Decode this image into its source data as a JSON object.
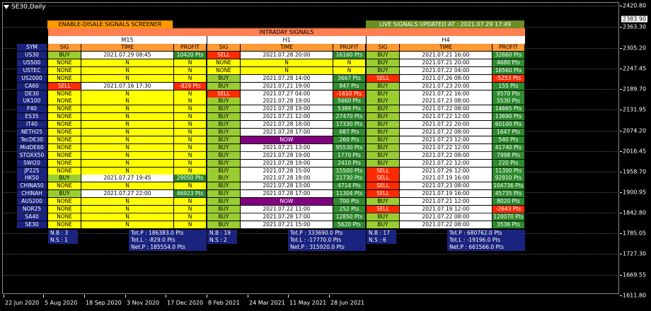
{
  "window": {
    "symbol_timeframe": "SE30,Daily"
  },
  "banners": {
    "enable": "ENABLE-DISALE SIGNALS SCREENER",
    "live": "LIVE SIGNALS UPDATED AT : 2021.07.29 17:49"
  },
  "headers": {
    "intraday": "INTRADAY SIGNALS",
    "timeframes": [
      "M15",
      "H1",
      "H4"
    ],
    "sym": "SYM",
    "sig": "SIG",
    "time": "TIME",
    "profit": "PROFIT"
  },
  "price_axis": {
    "labels": [
      "2420.80",
      "2363.30",
      "2305.20",
      "2247.45",
      "2189.70",
      "2131.95",
      "2074.20",
      "2016.45",
      "1958.70",
      "1900.95",
      "1842.80",
      "1785.05",
      "1727.30",
      "1669.55",
      "1611.80"
    ],
    "current": "2383.90"
  },
  "time_axis": [
    "22 Jun 2020",
    "5 Aug 2020",
    "18 Sep 2020",
    "3 Nov 2020",
    "17 Dec 2020",
    "8 Feb 2021",
    "24 Mar 2021",
    "11 May 2021",
    "28 Jun 2021"
  ],
  "colors": {
    "yellow": "#ffff00",
    "green": "#2e8b2e",
    "lightgreen": "#9acd32",
    "red": "#ff2a00",
    "navy": "#1a237e",
    "orange": "#ff9933"
  },
  "rows": [
    {
      "sym": "US30",
      "m15": [
        "BUY",
        "2021.07.29 08:45",
        "10420 Pts"
      ],
      "h1": [
        "SELL",
        "2021.07.28 20:00",
        "16160 Pts"
      ],
      "h4": [
        "BUY",
        "2021.07.21 16:00",
        "32660 Pts"
      ]
    },
    {
      "sym": "US500",
      "m15": [
        "NONE",
        "N",
        "N"
      ],
      "h1": [
        "NONE",
        "N",
        "N"
      ],
      "h4": [
        "BUY",
        "2021.07.21 20:00",
        "4680 Pts"
      ]
    },
    {
      "sym": "USTEC",
      "m15": [
        "NONE",
        "N",
        "N"
      ],
      "h1": [
        "NONE",
        "N",
        "N"
      ],
      "h4": [
        "BUY",
        "2021.07.22 04:00",
        "16560 Pts"
      ]
    },
    {
      "sym": "US2000",
      "m15": [
        "NONE",
        "N",
        "N"
      ],
      "h1": [
        "BUY",
        "2021.07.28 14:00",
        "3667 Pts"
      ],
      "h4": [
        "SELL",
        "2021.07.26 08:00",
        "-5253 Pts"
      ]
    },
    {
      "sym": "CA60",
      "m15": [
        "SELL",
        "2021.07.16 17:30",
        "-829 Pts"
      ],
      "h1": [
        "BUY",
        "2021.07.21 19:00",
        "847 Pts"
      ],
      "h4": [
        "BUY",
        "2021.07.23 20:00",
        "155 Pts"
      ]
    },
    {
      "sym": "DE30",
      "m15": [
        "NONE",
        "N",
        "N"
      ],
      "h1": [
        "SELL",
        "2021.07.27 04:00",
        "-1610 Pts"
      ],
      "h4": [
        "BUY",
        "2021.07.22 16:00",
        "9570 Pts"
      ]
    },
    {
      "sym": "UK100",
      "m15": [
        "NONE",
        "N",
        "N"
      ],
      "h1": [
        "BUY",
        "2021.07.28 19:00",
        "5660 Pts"
      ],
      "h4": [
        "BUY",
        "2021.07.23 08:00",
        "5530 Pts"
      ]
    },
    {
      "sym": "F40",
      "m15": [
        "NONE",
        "N",
        "N"
      ],
      "h1": [
        "BUY",
        "2021.07.28 19:00",
        "5389 Pts"
      ],
      "h4": [
        "BUY",
        "2021.07.22 08:00",
        "14665 Pts"
      ]
    },
    {
      "sym": "ES35",
      "m15": [
        "NONE",
        "N",
        "N"
      ],
      "h1": [
        "BUY",
        "2021.07.21 12:00",
        "27470 Pts"
      ],
      "h4": [
        "BUY",
        "2021.07.22 12:00",
        "13690 Pts"
      ]
    },
    {
      "sym": "IT40",
      "m15": [
        "NONE",
        "N",
        "N"
      ],
      "h1": [
        "BUY",
        "2021.07.28 18:00",
        "17330 Pts"
      ],
      "h4": [
        "BUY",
        "2021.07.22 20:00",
        "60100 Pts"
      ]
    },
    {
      "sym": "NETH25",
      "m15": [
        "NONE",
        "N",
        "N"
      ],
      "h1": [
        "BUY",
        "2021.07.28 17:00",
        "687 Pts"
      ],
      "h4": [
        "BUY",
        "2021.07.22 08:00",
        "1647 Pts"
      ]
    },
    {
      "sym": "TecDE30",
      "m15": [
        "NONE",
        "N",
        "N"
      ],
      "h1": [
        "NOW",
        "NOW",
        "260 Pts"
      ],
      "h4": [
        "BUY",
        "2021.07.23 12:00",
        "540 Pts"
      ]
    },
    {
      "sym": "MidDE60",
      "m15": [
        "NONE",
        "N",
        "N"
      ],
      "h1": [
        "BUY",
        "2021.07.21 13:00",
        "95530 Pts"
      ],
      "h4": [
        "BUY",
        "2021.07.22 12:00",
        "41740 Pts"
      ]
    },
    {
      "sym": "STOXX50",
      "m15": [
        "NONE",
        "N",
        "N"
      ],
      "h1": [
        "BUY",
        "2021.07.28 19:00",
        "1770 Pts"
      ],
      "h4": [
        "BUY",
        "2021.07.22 08:00",
        "7998 Pts"
      ]
    },
    {
      "sym": "SWI20",
      "m15": [
        "NONE",
        "N",
        "N"
      ],
      "h1": [
        "BUY",
        "2021.07.28 19:00",
        "2410 Pts"
      ],
      "h4": [
        "BUY",
        "2021.07.22 12:00",
        "220 Pts"
      ]
    },
    {
      "sym": "JP225",
      "m15": [
        "NONE",
        "N",
        "N"
      ],
      "h1": [
        "BUY",
        "2021.07.28 15:00",
        "15500 Pts"
      ],
      "h4": [
        "SELL",
        "2021.07.26 12:00",
        "11300 Pts"
      ]
    },
    {
      "sym": "HK50",
      "m15": [
        "BUY",
        "2021.07.27 19:45",
        "29050 Pts"
      ],
      "h1": [
        "BUY",
        "2021.07.28 18:00",
        "21730 Pts"
      ],
      "h4": [
        "SELL",
        "2021.07.19 16:00",
        "92910 Pts"
      ]
    },
    {
      "sym": "CHINA50",
      "m15": [
        "NONE",
        "N",
        "N"
      ],
      "h1": [
        "BUY",
        "2021.07.28 13:00",
        "4714 Pts"
      ],
      "h4": [
        "SELL",
        "2021.07.23 08:00",
        "104736 Pts"
      ]
    },
    {
      "sym": "CHINAH",
      "m15": [
        "BUY",
        "2021.07.27 22:00",
        "46923 Pts"
      ],
      "h1": [
        "BUY",
        "2021.07.28 17:00",
        "11304 Pts"
      ],
      "h4": [
        "SELL",
        "2021.07.19 16:00",
        "45735 Pts"
      ]
    },
    {
      "sym": "AUS200",
      "m15": [
        "NONE",
        "N",
        "N"
      ],
      "h1": [
        "NOW",
        "NOW",
        "700 Pts"
      ],
      "h4": [
        "BUY",
        "2021.07.21 12:00",
        "8020 Pts"
      ]
    },
    {
      "sym": "NOR25",
      "m15": [
        "NONE",
        "N",
        "N"
      ],
      "h1": [
        "BUY",
        "2021.07.22 11:00",
        "252 Pts"
      ],
      "h4": [
        "SELL",
        "2021.07.19 12:00",
        "-2643 Pts"
      ]
    },
    {
      "sym": "SA40",
      "m15": [
        "NONE",
        "N",
        "N"
      ],
      "h1": [
        "BUY",
        "2021.07.28 17:00",
        "12850 Pts"
      ],
      "h4": [
        "BUY",
        "2021.07.22 08:00",
        "120070 Pts"
      ]
    },
    {
      "sym": "SE30",
      "m15": [
        "NONE",
        "N",
        "N"
      ],
      "h1": [
        "BUY",
        "2021.07.21 15:00",
        "5620 Pts"
      ],
      "h4": [
        "BUY",
        "2021.07.22 08:00",
        "3536 Pts"
      ]
    }
  ],
  "summary": {
    "m15": {
      "nb": "N.B : 3",
      "ns": "N.S : 1",
      "totp": "Tot.P : 186383.0 Pts",
      "totl": "Tot.L : -829.0 Pts",
      "netp": "Net.P : 185554.0 Pts"
    },
    "h1": {
      "nb": "N.B : 19",
      "ns": "N.S : 2",
      "totp": "Tot.P : 333690.0 Pts",
      "totl": "Tot.L : -17770.0 Pts",
      "netp": "Net.P : 315920.0 Pts"
    },
    "h4": {
      "nb": "N.B : 17",
      "ns": "N.S : 6",
      "totp": "Tot.P : 680762.0 Pts",
      "totl": "Tot.L : -19196.0 Pts",
      "netp": "Net.P : 661566.0 Pts"
    }
  }
}
